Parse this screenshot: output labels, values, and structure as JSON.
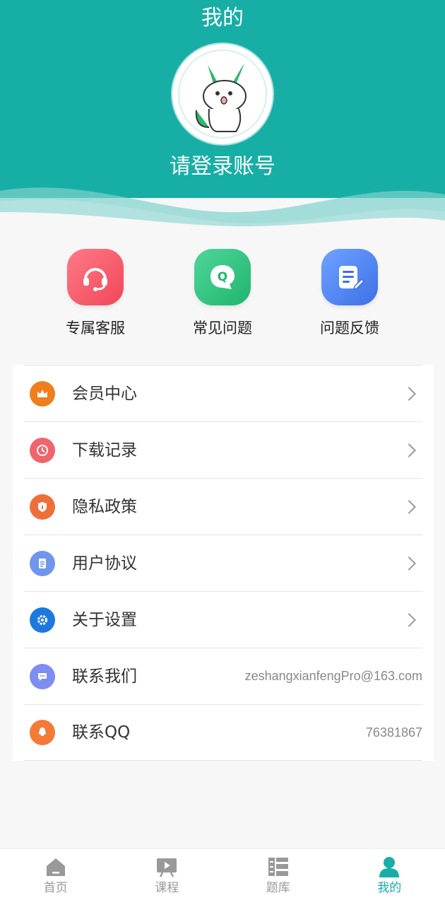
{
  "colors": {
    "primary": "#17aea6",
    "support_icon": "#f25d6b",
    "faq_icon": "#2fc07d",
    "feedback_icon": "#4d82f2",
    "inactive_tab": "#999999"
  },
  "header": {
    "title": "我的",
    "login_prompt": "请登录账号",
    "avatar_icon": "rabbit-mascot-icon"
  },
  "quick_actions": [
    {
      "label": "专属客服",
      "icon": "headset-icon"
    },
    {
      "label": "常见问题",
      "icon": "q-bubble-icon"
    },
    {
      "label": "问题反馈",
      "icon": "edit-document-icon"
    }
  ],
  "menu": [
    {
      "label": "会员中心",
      "icon": "crown-icon",
      "icon_color": "#f07e1c",
      "value": ""
    },
    {
      "label": "下载记录",
      "icon": "clock-icon",
      "icon_color": "#f0656b",
      "value": ""
    },
    {
      "label": "隐私政策",
      "icon": "shield-icon",
      "icon_color": "#ef6f3a",
      "value": ""
    },
    {
      "label": "用户协议",
      "icon": "document-icon",
      "icon_color": "#6f95ec",
      "value": ""
    },
    {
      "label": "关于设置",
      "icon": "gear-icon",
      "icon_color": "#1d79e0",
      "value": ""
    },
    {
      "label": "联系我们",
      "icon": "chat-icon",
      "icon_color": "#7d8df0",
      "value": "zeshangxianfengPro@163.com"
    },
    {
      "label": "联系QQ",
      "icon": "qq-icon",
      "icon_color": "#f47a36",
      "value": "76381867"
    }
  ],
  "tabs": [
    {
      "label": "首页",
      "icon": "home-icon"
    },
    {
      "label": "课程",
      "icon": "play-board-icon"
    },
    {
      "label": "题库",
      "icon": "question-bank-icon"
    },
    {
      "label": "我的",
      "icon": "user-icon"
    }
  ]
}
